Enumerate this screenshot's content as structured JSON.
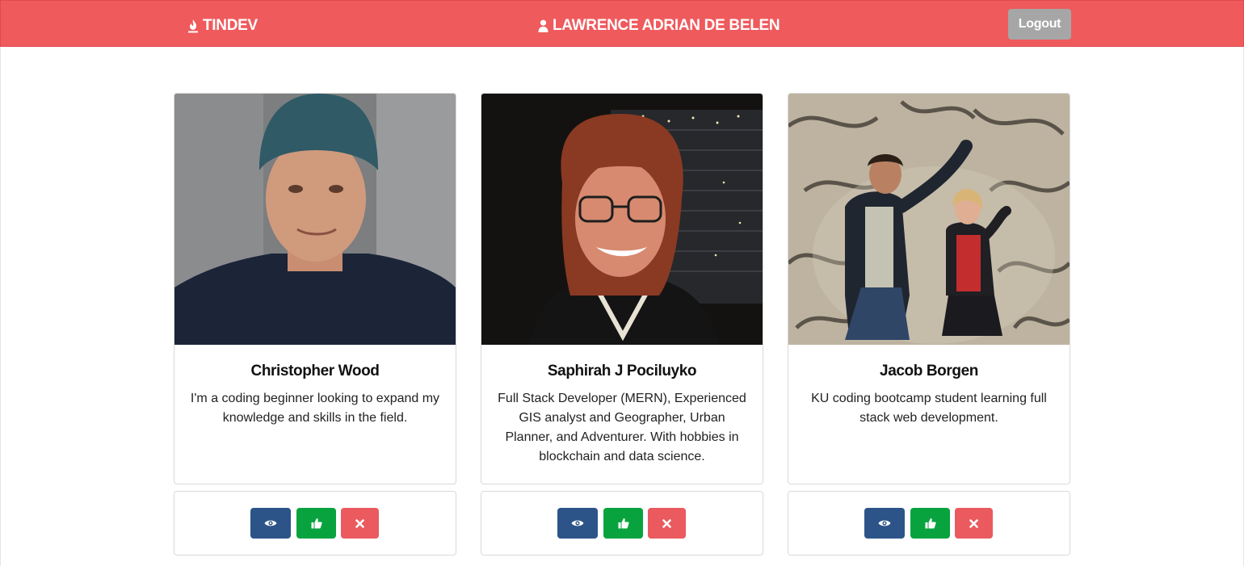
{
  "header": {
    "brand": "TINDEV",
    "brand_icon": "fire-icon",
    "user_name": "LAWRENCE ADRIAN DE BELEN",
    "user_icon": "user-icon",
    "logout_label": "Logout"
  },
  "colors": {
    "navbar": "#ef5a5d",
    "logout": "#a6a6a6",
    "view_button": "#2c5489",
    "like_button": "#08a33f",
    "pass_button": "#ea5a5f"
  },
  "profiles": [
    {
      "name": "Christopher Wood",
      "bio": "I'm a coding beginner looking to expand my knowledge and skills in the field.",
      "photo": "portrait of man in teal beanie"
    },
    {
      "name": "Saphirah J Pociluyko",
      "bio": "Full Stack Developer (MERN), Experienced GIS analyst and Geographer, Urban Planner, and Adventurer. With hobbies in blockchain and data science.",
      "photo": "portrait of woman with glasses"
    },
    {
      "name": "Jacob Borgen",
      "bio": "KU coding bootcamp student learning full stack web development.",
      "photo": "two people posing in front of mural"
    }
  ],
  "actions": {
    "view_icon": "eye-icon",
    "like_icon": "thumbs-up-icon",
    "pass_icon": "close-icon"
  }
}
